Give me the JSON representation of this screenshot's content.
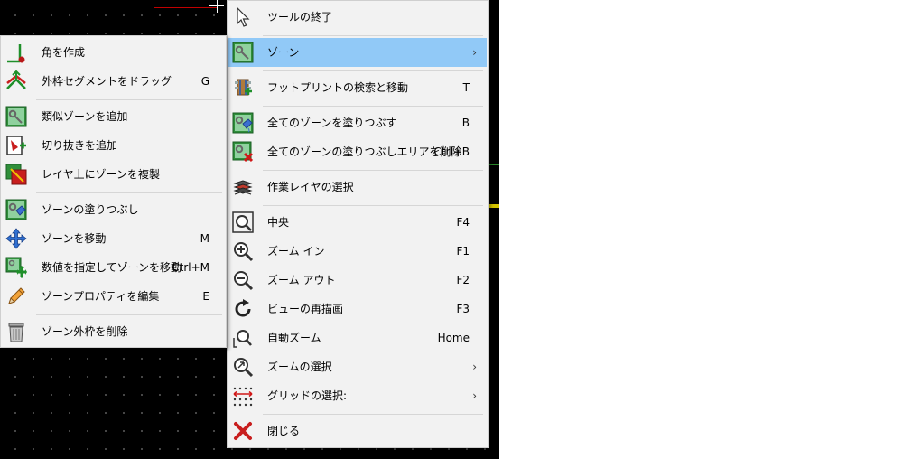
{
  "main_menu": {
    "items": [
      {
        "label": "ツールの終了",
        "shortcut": "",
        "icon": "cursor-arrow-icon"
      },
      {
        "label": "ゾーン",
        "shortcut": "",
        "icon": "zone-icon",
        "submenu_arrow": "›"
      },
      {
        "label": "フットプリントの検索と移動",
        "shortcut": "T",
        "icon": "footprint-move-icon"
      },
      {
        "label": "全てのゾーンを塗りつぶす",
        "shortcut": "B",
        "icon": "zone-fill-all-icon"
      },
      {
        "label": "全てのゾーンの塗りつぶしエリアを削除",
        "shortcut": "Ctrl+B",
        "icon": "zone-unfill-all-icon"
      },
      {
        "label": "作業レイヤの選択",
        "shortcut": "",
        "icon": "layers-stack-icon"
      },
      {
        "label": "中央",
        "shortcut": "F4",
        "icon": "zoom-center-icon"
      },
      {
        "label": "ズーム イン",
        "shortcut": "F1",
        "icon": "zoom-in-icon"
      },
      {
        "label": "ズーム アウト",
        "shortcut": "F2",
        "icon": "zoom-out-icon"
      },
      {
        "label": "ビューの再描画",
        "shortcut": "F3",
        "icon": "redraw-icon"
      },
      {
        "label": "自動ズーム",
        "shortcut": "Home",
        "icon": "zoom-fit-icon"
      },
      {
        "label": "ズームの選択",
        "shortcut": "",
        "icon": "zoom-select-icon",
        "submenu_arrow": "›"
      },
      {
        "label": "グリッドの選択:",
        "shortcut": "",
        "icon": "grid-select-icon",
        "submenu_arrow": "›"
      },
      {
        "label": "閉じる",
        "shortcut": "",
        "icon": "close-x-icon"
      }
    ]
  },
  "sub_menu": {
    "items": [
      {
        "label": "角を作成",
        "shortcut": "",
        "icon": "create-corner-icon"
      },
      {
        "label": "外枠セグメントをドラッグ",
        "shortcut": "G",
        "icon": "drag-segment-icon"
      },
      {
        "label": "類似ゾーンを追加",
        "shortcut": "",
        "icon": "add-similar-zone-icon"
      },
      {
        "label": "切り抜きを追加",
        "shortcut": "",
        "icon": "add-cutout-icon"
      },
      {
        "label": "レイヤ上にゾーンを複製",
        "shortcut": "",
        "icon": "duplicate-zone-layer-icon"
      },
      {
        "label": "ゾーンの塗りつぶし",
        "shortcut": "",
        "icon": "zone-fill-icon"
      },
      {
        "label": "ゾーンを移動",
        "shortcut": "M",
        "icon": "move-icon"
      },
      {
        "label": "数値を指定してゾーンを移動",
        "shortcut": "Ctrl+M",
        "icon": "move-exact-icon"
      },
      {
        "label": "ゾーンプロパティを編集",
        "shortcut": "E",
        "icon": "pencil-icon"
      },
      {
        "label": "ゾーン外枠を削除",
        "shortcut": "",
        "icon": "trash-icon"
      }
    ]
  },
  "colors": {
    "highlight": "#91c9f7",
    "canvas_bg": "#000000",
    "menu_bg": "#f2f2f2"
  }
}
